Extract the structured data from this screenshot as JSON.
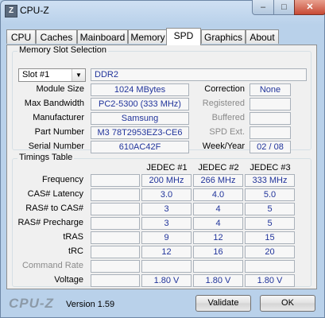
{
  "window": {
    "title": "CPU-Z",
    "icon_label": "Z",
    "minimize_glyph": "–",
    "maximize_glyph": "□",
    "close_glyph": "✕"
  },
  "tabs": [
    {
      "label": "CPU"
    },
    {
      "label": "Caches"
    },
    {
      "label": "Mainboard"
    },
    {
      "label": "Memory"
    },
    {
      "label": "SPD"
    },
    {
      "label": "Graphics"
    },
    {
      "label": "About"
    }
  ],
  "active_tab": "SPD",
  "memory_slot": {
    "group_title": "Memory Slot Selection",
    "slot_value": "Slot #1",
    "type": "DDR2",
    "labels": {
      "module_size": "Module Size",
      "max_bandwidth": "Max Bandwidth",
      "manufacturer": "Manufacturer",
      "part_number": "Part Number",
      "serial_number": "Serial Number",
      "correction": "Correction",
      "registered": "Registered",
      "buffered": "Buffered",
      "spd_ext": "SPD Ext.",
      "week_year": "Week/Year"
    },
    "values": {
      "module_size": "1024 MBytes",
      "max_bandwidth": "PC2-5300 (333 MHz)",
      "manufacturer": "Samsung",
      "part_number": "M3 78T2953EZ3-CE6",
      "serial_number": "610AC42F",
      "correction": "None",
      "registered": "",
      "buffered": "",
      "spd_ext": "",
      "week_year": "02 / 08"
    }
  },
  "timings": {
    "group_title": "Timings Table",
    "columns": [
      "JEDEC #1",
      "JEDEC #2",
      "JEDEC #3"
    ],
    "rows": [
      {
        "label": "Frequency",
        "values": [
          "200 MHz",
          "266 MHz",
          "333 MHz"
        ],
        "dim": false
      },
      {
        "label": "CAS# Latency",
        "values": [
          "3.0",
          "4.0",
          "5.0"
        ],
        "dim": false
      },
      {
        "label": "RAS# to CAS#",
        "values": [
          "3",
          "4",
          "5"
        ],
        "dim": false
      },
      {
        "label": "RAS# Precharge",
        "values": [
          "3",
          "4",
          "5"
        ],
        "dim": false
      },
      {
        "label": "tRAS",
        "values": [
          "9",
          "12",
          "15"
        ],
        "dim": false
      },
      {
        "label": "tRC",
        "values": [
          "12",
          "16",
          "20"
        ],
        "dim": false
      },
      {
        "label": "Command Rate",
        "values": [
          "",
          "",
          ""
        ],
        "dim": true
      },
      {
        "label": "Voltage",
        "values": [
          "1.80 V",
          "1.80 V",
          "1.80 V"
        ],
        "dim": false
      }
    ]
  },
  "footer": {
    "logo": "CPU-Z",
    "version": "Version 1.59",
    "validate_label": "Validate",
    "ok_label": "OK"
  }
}
